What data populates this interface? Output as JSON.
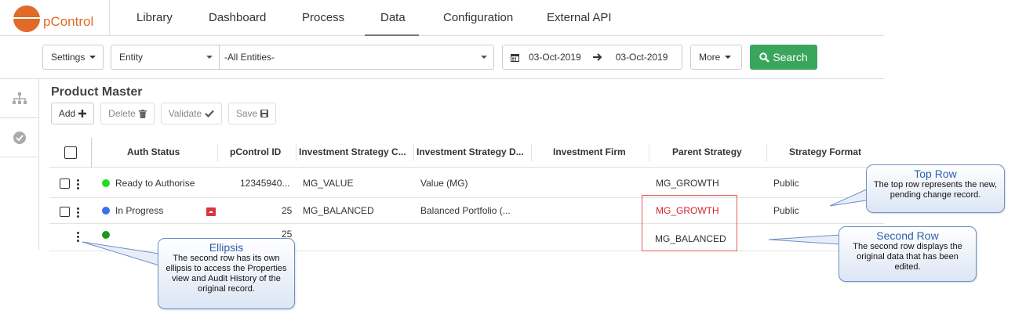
{
  "app": {
    "logo_text": "pControl",
    "brand_color": "#e06a26"
  },
  "nav": {
    "items": [
      "Library",
      "Dashboard",
      "Process",
      "Data",
      "Configuration",
      "External API"
    ],
    "active": "Data"
  },
  "filters": {
    "settings_label": "Settings",
    "entity_label": "Entity",
    "entities_value": "-All Entities-",
    "date_from": "03-Oct-2019",
    "date_to": "03-Oct-2019",
    "more_label": "More",
    "search_label": "Search",
    "search_color": "#3aa65c"
  },
  "sidebar": {
    "icons": [
      "hierarchy-icon",
      "check-circle-icon"
    ]
  },
  "page": {
    "title": "Product Master"
  },
  "toolbar": {
    "add_label": "Add",
    "delete_label": "Delete",
    "validate_label": "Validate",
    "save_label": "Save"
  },
  "table": {
    "columns": [
      "Auth Status",
      "pControl ID",
      "Investment Strategy C...",
      "Investment Strategy D...",
      "Investment Firm",
      "Parent Strategy",
      "Strategy Format"
    ],
    "rows": [
      {
        "status": "Ready to Authorise",
        "status_color": "#22dd22",
        "id": "12345940...",
        "code": "MG_VALUE",
        "desc": "Value (MG)",
        "firm": "",
        "parent": "MG_GROWTH",
        "format": "Public"
      },
      {
        "status": "In Progress",
        "status_color": "#3a6ff0",
        "id": "25",
        "code": "MG_BALANCED",
        "desc": "Balanced Portfolio (...",
        "firm": "",
        "parent": "MG_GROWTH",
        "format": "Public"
      },
      {
        "status": "",
        "status_color": "#1a9a1a",
        "id": "25",
        "code": "",
        "desc": "",
        "firm": "",
        "parent": "MG_BALANCED",
        "format": ""
      }
    ]
  },
  "callouts": {
    "top_row": {
      "title": "Top Row",
      "body": "The top row represents the new, pending change record."
    },
    "second_row": {
      "title": "Second Row",
      "body": "The second row displays the original data that has been edited."
    },
    "ellipsis": {
      "title": "Ellipsis",
      "body": "The second row has its own ellipsis to access the Properties view and Audit History of the original record."
    }
  }
}
